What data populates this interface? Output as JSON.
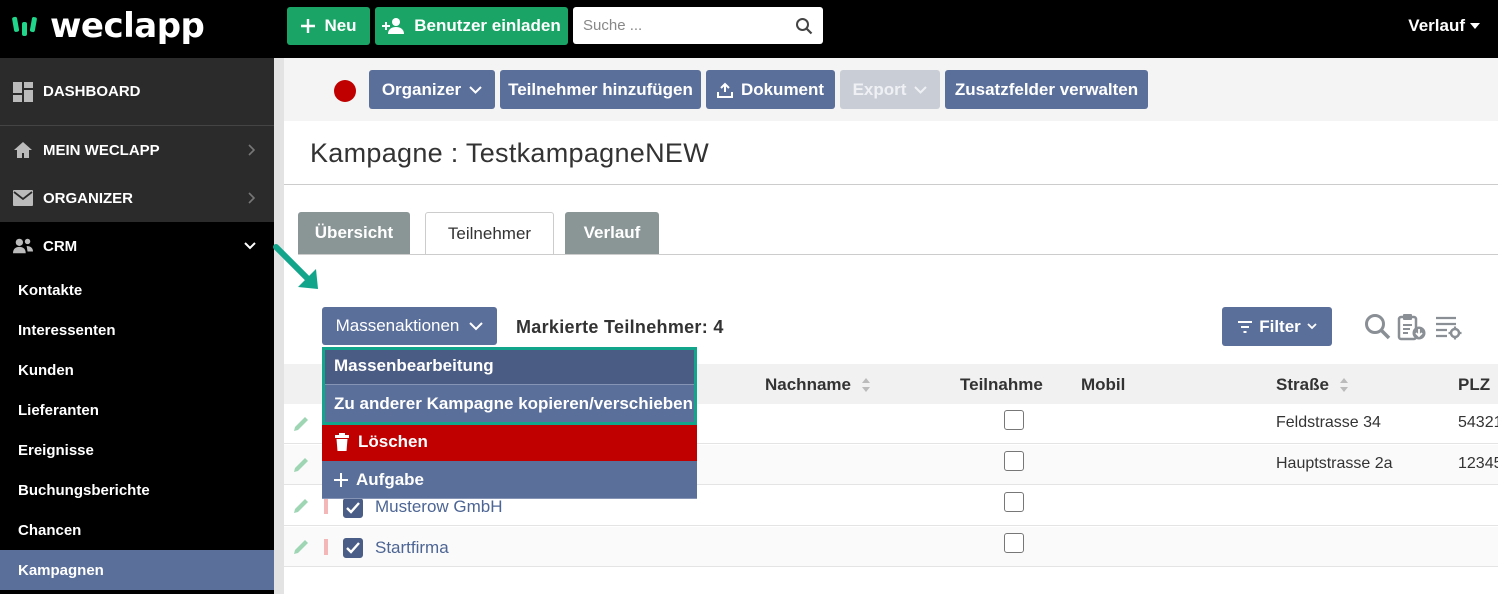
{
  "topbar": {
    "logo_text": "weclapp",
    "new_label": "Neu",
    "invite_label": "Benutzer einladen",
    "search_placeholder": "Suche ...",
    "history_label": "Verlauf"
  },
  "sidebar": {
    "dashboard": "DASHBOARD",
    "mein": "MEIN WECLAPP",
    "organizer": "ORGANIZER",
    "crm": "CRM",
    "items": [
      "Kontakte",
      "Interessenten",
      "Kunden",
      "Lieferanten",
      "Ereignisse",
      "Buchungsberichte",
      "Chancen",
      "Kampagnen"
    ],
    "active_item": "Kampagnen"
  },
  "toolbar": {
    "status_color": "#c00000",
    "organizer": "Organizer",
    "add_participants": "Teilnehmer hinzufügen",
    "document": "Dokument",
    "export": "Export",
    "custom_fields": "Zusatzfelder verwalten"
  },
  "page": {
    "title": "Kampagne : TestkampagneNEW"
  },
  "tabs": [
    {
      "label": "Übersicht",
      "active": false
    },
    {
      "label": "Teilnehmer",
      "active": true
    },
    {
      "label": "Verlauf",
      "active": false
    }
  ],
  "participants": {
    "mass_actions": "Massenaktionen",
    "marked_label": "Markierte Teilnehmer: 4",
    "filter": "Filter"
  },
  "dropdown": {
    "items": [
      "Massenbearbeitung",
      "Zu anderer Kampagne kopieren/verschieben",
      "Löschen",
      "Aufgabe"
    ]
  },
  "table": {
    "columns": [
      "Nachname",
      "Teilnahme",
      "Mobil",
      "Straße",
      "PLZ"
    ],
    "rows": [
      {
        "name": "",
        "street": "Feldstrasse 34",
        "zip": "54321",
        "checked": true
      },
      {
        "name": "",
        "street": "Hauptstrasse 2a",
        "zip": "12345",
        "checked": true
      },
      {
        "name": "Musterow GmbH",
        "street": "",
        "zip": "",
        "checked": true
      },
      {
        "name": "Startfirma",
        "street": "",
        "zip": "",
        "checked": true
      }
    ]
  },
  "colors": {
    "brand_green": "#1aa567",
    "primary": "#5b6f9b",
    "danger": "#c00000",
    "highlight": "#12a58c"
  }
}
